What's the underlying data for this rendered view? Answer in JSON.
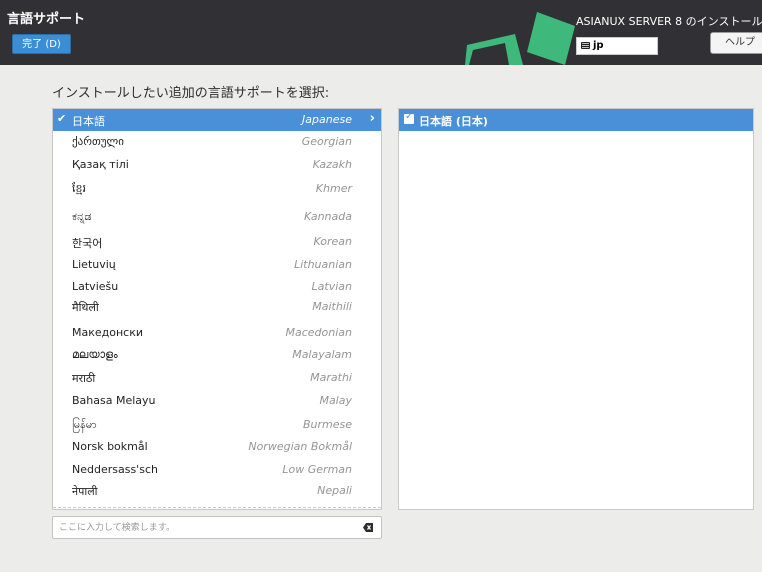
{
  "header": {
    "title": "言語サポート",
    "done_label": "完了 (D)",
    "product": "ASIANUX SERVER 8 のインストール",
    "keyboard": "jp",
    "help_label": "ヘルプ"
  },
  "prompt": "インストールしたい追加の言語サポートを選択:",
  "languages": [
    {
      "native": "日本語",
      "english": "Japanese",
      "selected": true
    },
    {
      "native": "ქართული",
      "english": "Georgian"
    },
    {
      "native": "Қазақ тілі",
      "english": "Kazakh"
    },
    {
      "native": "ខ្មែរ",
      "english": "Khmer"
    },
    {
      "native": "ಕನ್ನಡ",
      "english": "Kannada"
    },
    {
      "native": "한국어",
      "english": "Korean"
    },
    {
      "native": "Lietuvių",
      "english": "Lithuanian"
    },
    {
      "native": "Latviešu",
      "english": "Latvian"
    },
    {
      "native": "मैथिली",
      "english": "Maithili"
    },
    {
      "native": "Македонски",
      "english": "Macedonian"
    },
    {
      "native": "മലയാളം",
      "english": "Malayalam"
    },
    {
      "native": "मराठी",
      "english": "Marathi"
    },
    {
      "native": "Bahasa Melayu",
      "english": "Malay"
    },
    {
      "native": "မြန်မာ",
      "english": "Burmese"
    },
    {
      "native": "Norsk bokmål",
      "english": "Norwegian Bokmål"
    },
    {
      "native": "Neddersass'sch",
      "english": "Low German"
    },
    {
      "native": "नेपाली",
      "english": "Nepali"
    }
  ],
  "search": {
    "placeholder": "ここに入力して検索します。",
    "value": ""
  },
  "locales": [
    {
      "label": "日本語 (日本)",
      "checked": true
    }
  ],
  "colors": {
    "accent": "#4a90d9",
    "header_bg": "#303035",
    "logo_green": "#3fb97b"
  }
}
